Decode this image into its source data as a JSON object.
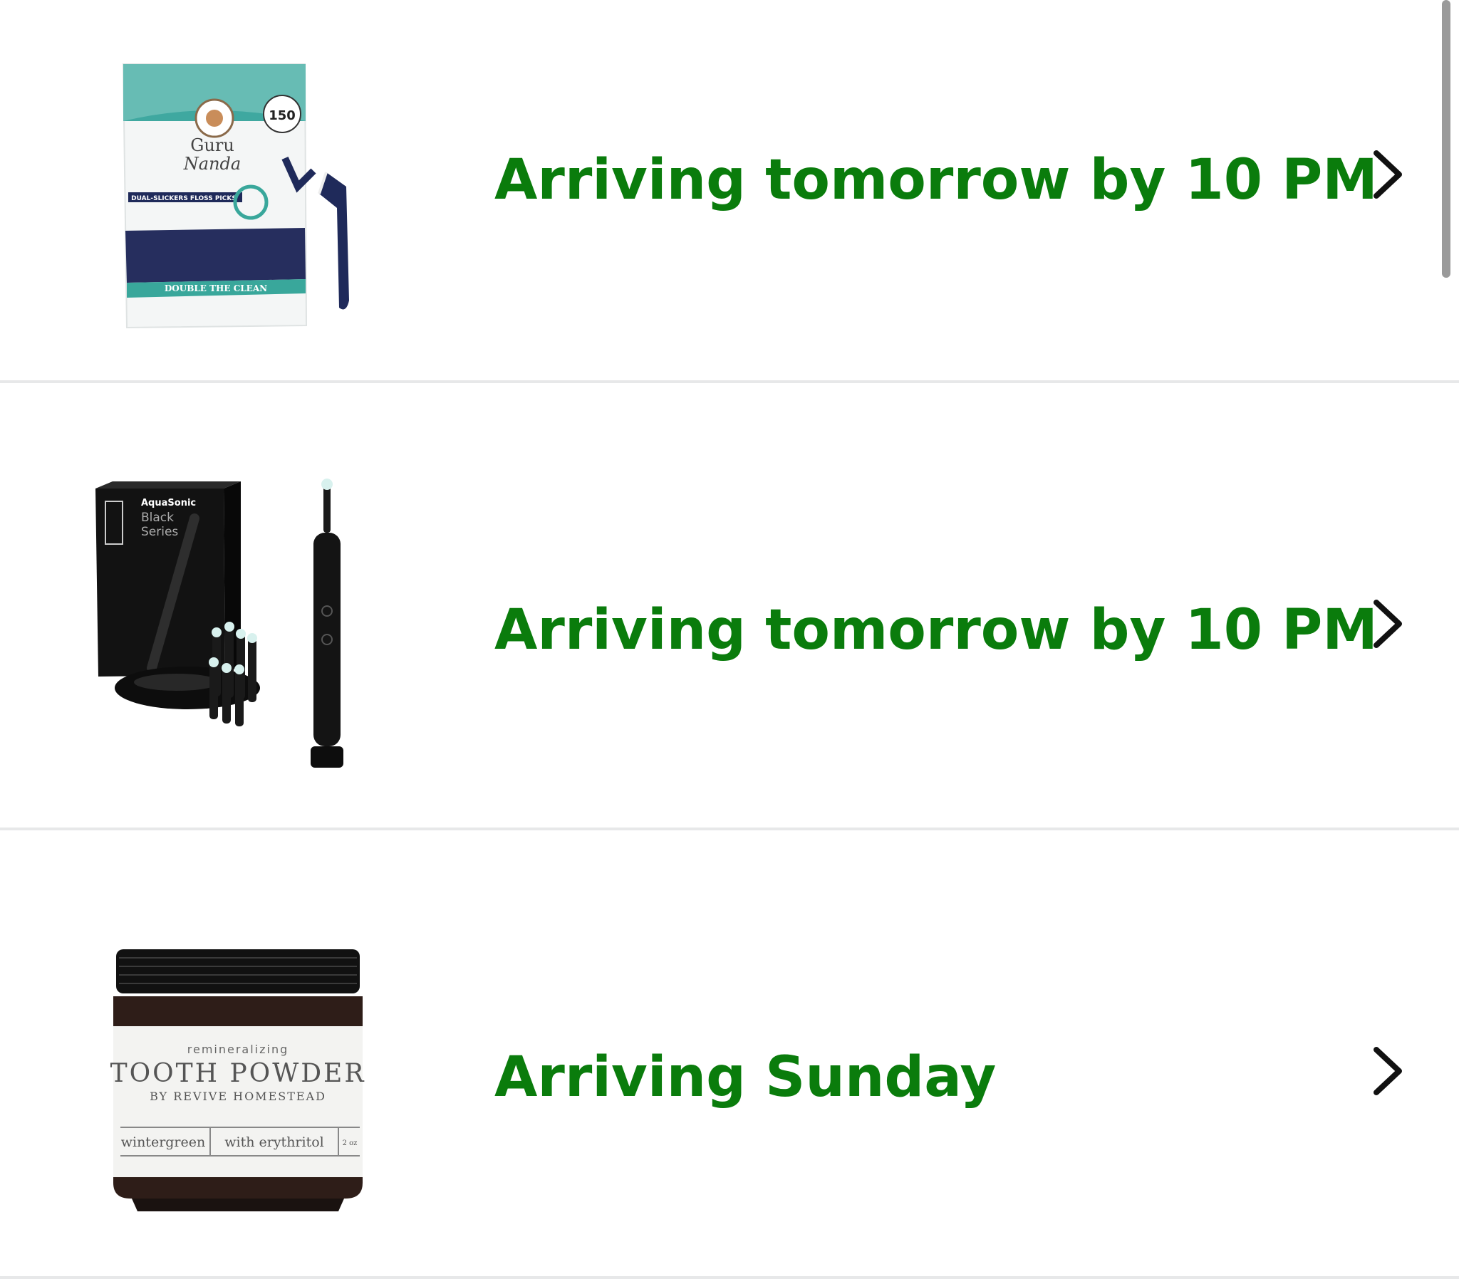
{
  "orders": [
    {
      "image_alt": "Guru Nanda Dual-Slickers floss picks",
      "product_art": {
        "brand_line1": "Guru",
        "brand_line2": "Nanda",
        "badge_count": "150",
        "tagline": "DOUBLE THE CLEAN",
        "subline": "DUAL-SLICKERS FLOSS PICKS"
      },
      "status": "Arriving tomorrow by 10 PM"
    },
    {
      "image_alt": "AquaSonic Black Series toothbrush",
      "product_art": {
        "brand": "AquaSonic",
        "line1": "Black",
        "line2": "Series"
      },
      "status": "Arriving tomorrow by 10 PM"
    },
    {
      "image_alt": "Tooth Powder by Revive Homestead",
      "product_art": {
        "top": "remineralizing",
        "title": "TOOTH POWDER",
        "maker": "BY REVIVE HOMESTEAD",
        "flavor": "wintergreen",
        "feature": "with erythritol",
        "size": "2 oz"
      },
      "status": "Arriving Sunday"
    }
  ],
  "icons": {
    "chevron": "chevron-right-icon"
  },
  "colors": {
    "status_green": "#0a7c0c",
    "divider": "#e7e8e9",
    "chevron": "#111111"
  }
}
